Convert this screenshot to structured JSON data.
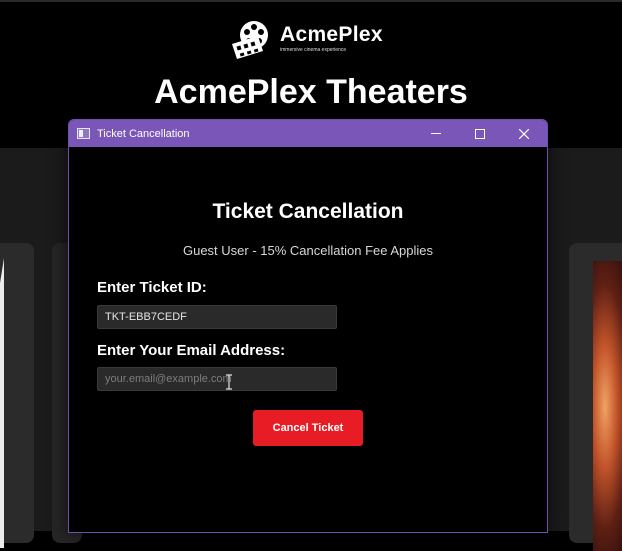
{
  "site": {
    "logo_name": "AcmePlex",
    "logo_tagline": "immersive cinema experience",
    "title": "AcmePlex Theaters"
  },
  "dialog": {
    "window_title": "Ticket Cancellation",
    "heading": "Ticket Cancellation",
    "subtitle": "Guest User - 15% Cancellation Fee Applies",
    "ticket_label": "Enter Ticket ID:",
    "ticket_value": "TKT-EBB7CEDF",
    "email_label": "Enter Your Email Address:",
    "email_placeholder": "your.email@example.com",
    "email_value": "",
    "cancel_button": "Cancel Ticket"
  },
  "colors": {
    "titlebar": "#7a56b8",
    "accent_button": "#e81c24",
    "background": "#000000"
  },
  "icons": [
    "film-reel-icon",
    "app-window-icon",
    "minimize-icon",
    "maximize-icon",
    "close-icon",
    "text-cursor-icon"
  ]
}
